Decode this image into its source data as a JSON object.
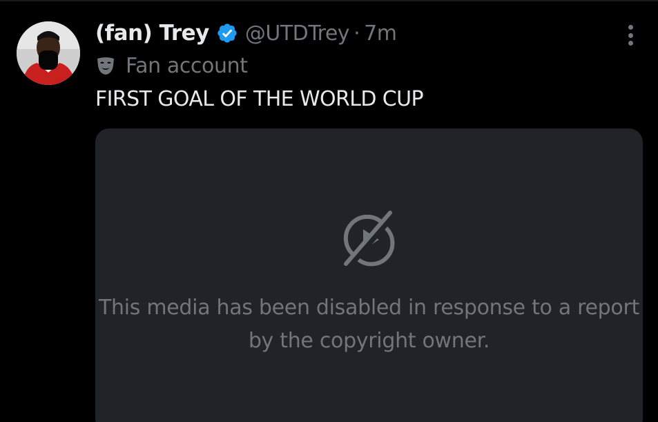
{
  "tweet": {
    "author": {
      "display_name": "(fan) Trey",
      "handle": "@UTDTrey",
      "verified": true,
      "avatar_icon": "avatar-photo"
    },
    "separator": "·",
    "timestamp": "7m",
    "account_label": {
      "icon": "mask-icon",
      "text": "Fan account"
    },
    "text": "FIRST GOAL OF THE WORLD CUP",
    "media": {
      "status_icon": "media-disabled-icon",
      "message": "This media has been disabled in response to a report by the copyright owner."
    }
  },
  "colors": {
    "background": "#000000",
    "primary_text": "#e7e9ea",
    "secondary_text": "#71767b",
    "verified_blue": "#1d9bf0",
    "media_card": "#202327"
  }
}
